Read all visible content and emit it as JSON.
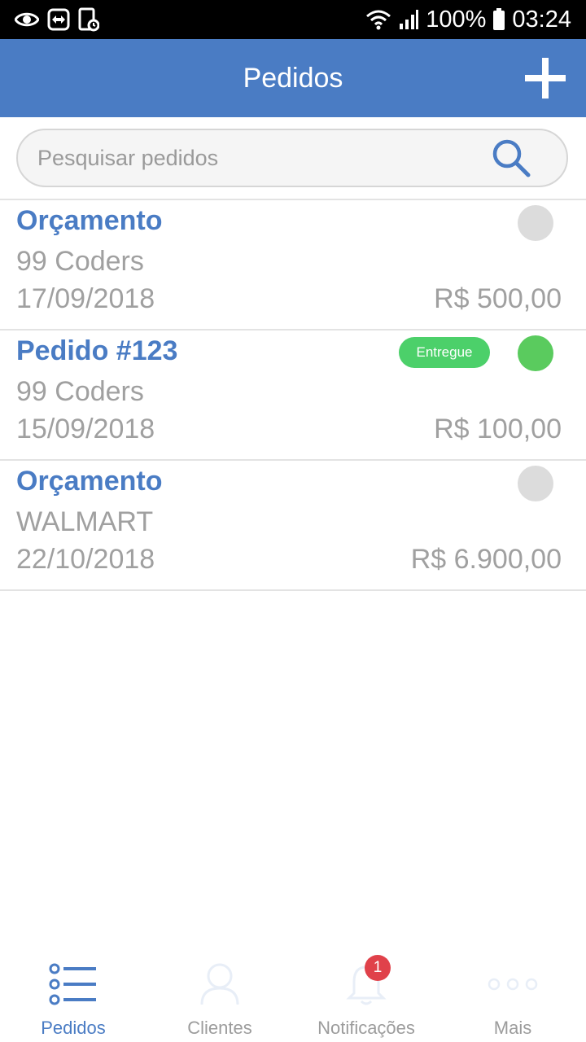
{
  "status_bar": {
    "battery": "100%",
    "time": "03:24",
    "icons": [
      "eye-icon",
      "teamviewer-icon",
      "screen-lock-icon",
      "wifi-icon",
      "signal-icon",
      "battery-icon"
    ]
  },
  "header": {
    "title": "Pedidos",
    "add_icon": "plus-icon"
  },
  "search": {
    "placeholder": "Pesquisar pedidos",
    "icon": "search-icon"
  },
  "orders": [
    {
      "title": "Orçamento",
      "client": "99 Coders",
      "date": "17/09/2018",
      "total": "R$ 500,00",
      "badge": "",
      "status_color": "#dcdcdc"
    },
    {
      "title": "Pedido #123",
      "client": "99 Coders",
      "date": "15/09/2018",
      "total": "R$ 100,00",
      "badge": "Entregue",
      "status_color": "#5acb5e"
    },
    {
      "title": "Orçamento",
      "client": "WALMART",
      "date": "22/10/2018",
      "total": "R$ 6.900,00",
      "badge": "",
      "status_color": "#dcdcdc"
    }
  ],
  "bottom_nav": {
    "items": [
      {
        "label": "Pedidos",
        "icon": "list-icon",
        "active": true
      },
      {
        "label": "Clientes",
        "icon": "user-icon",
        "active": false
      },
      {
        "label": "Notificações",
        "icon": "bell-icon",
        "active": false,
        "badge": "1"
      },
      {
        "label": "Mais",
        "icon": "more-icon",
        "active": false
      }
    ]
  },
  "colors": {
    "primary": "#4a7cc4",
    "badge_green": "#4cd06a",
    "notification_red": "#e0414a",
    "inactive": "#9c9c9c"
  }
}
